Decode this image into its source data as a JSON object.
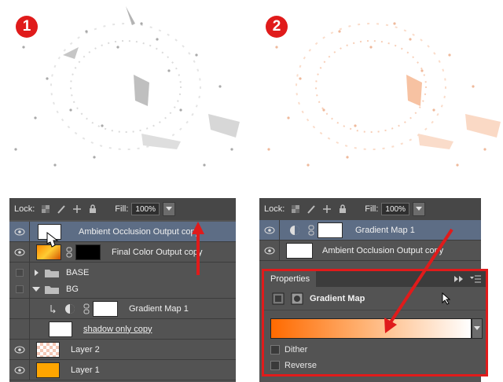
{
  "steps": [
    {
      "number": "1"
    },
    {
      "number": "2"
    }
  ],
  "colors": {
    "accent_red": "#e01b1b",
    "panel_bg": "#535353",
    "selection_bg": "#5d6d85",
    "gradient_start": "#ff6a00",
    "gradient_end": "#ffffff",
    "layer1_fill": "#ffa500"
  },
  "left_panel": {
    "lock_label": "Lock:",
    "fill_label": "Fill:",
    "fill_value": "100%",
    "layers": [
      {
        "name": "Ambient Occlusion Output copy",
        "selected": true,
        "visible": true,
        "thumb": "white",
        "icon": "eye-icon"
      },
      {
        "name": "Final Color Output copy",
        "selected": false,
        "visible": true,
        "thumb": "final",
        "icon": "eye-icon"
      },
      {
        "name": "BASE",
        "type": "group",
        "collapsed": true,
        "visible": false
      },
      {
        "name": "BG",
        "type": "group",
        "collapsed": false,
        "visible": false
      },
      {
        "name": "Gradient Map 1",
        "type": "adjustment",
        "visible": false
      },
      {
        "name": "shadow only copy",
        "visible": false,
        "thumb": "white"
      },
      {
        "name": "Layer 2",
        "visible": true,
        "thumb": "pink"
      },
      {
        "name": "Layer 1",
        "visible": true,
        "thumb": "orange"
      }
    ]
  },
  "right_panel": {
    "lock_label": "Lock:",
    "fill_label": "Fill:",
    "fill_value": "100%",
    "layers": [
      {
        "name": "Gradient Map 1",
        "selected": true,
        "visible": true
      },
      {
        "name": "Ambient Occlusion Output copy",
        "selected": false,
        "visible": true
      }
    ]
  },
  "properties": {
    "tab_label": "Properties",
    "title": "Gradient Map",
    "options": [
      {
        "label": "Dither",
        "checked": false
      },
      {
        "label": "Reverse",
        "checked": false
      }
    ]
  }
}
